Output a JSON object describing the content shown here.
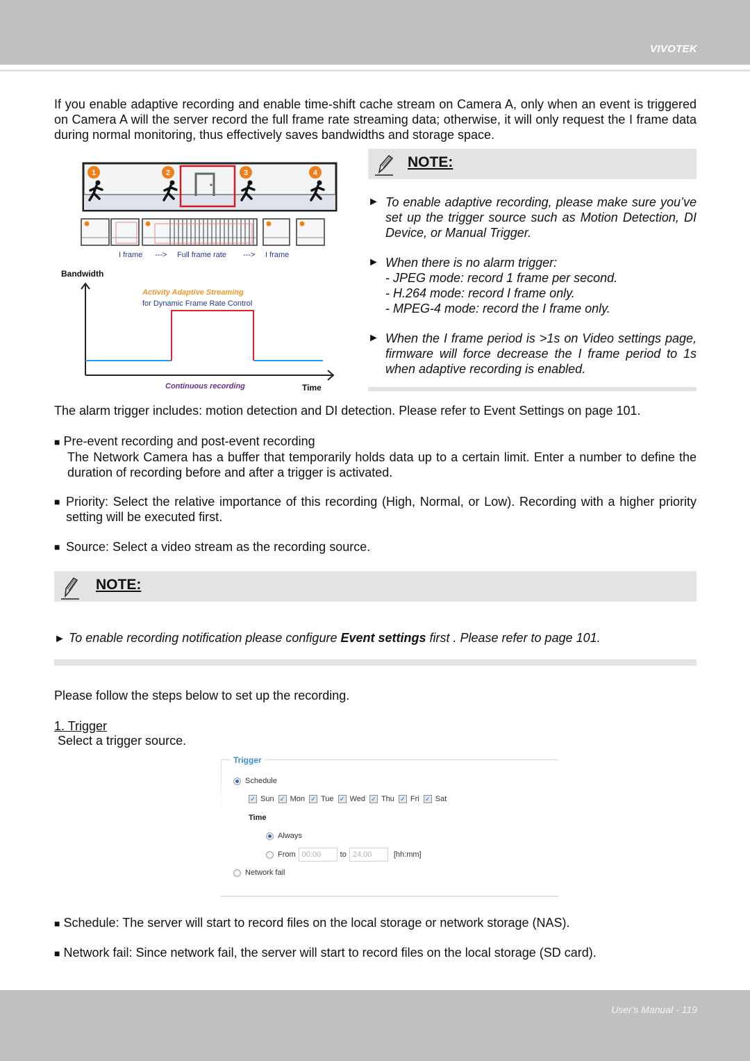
{
  "header": {
    "brand": "VIVOTEK"
  },
  "intro": "If you enable adaptive recording and enable time-shift cache stream on Camera A, only when an event is triggered on Camera A will the server record the full frame rate streaming data; otherwise, it will only request the I frame data during normal monitoring, thus effectively saves bandwidths and storage space.",
  "figure": {
    "steps": [
      "1",
      "2",
      "3",
      "4"
    ],
    "frame_labels": {
      "left": "I frame",
      "arrow1": "--->",
      "middle": "Full frame rate",
      "arrow2": "--->",
      "right": "I frame"
    },
    "ylabel": "Bandwidth",
    "xlabel": "Time",
    "title_orange": "Activity Adaptive Streaming",
    "title_blue": "for Dynamic Frame Rate Control",
    "baseline_label": "Continuous recording",
    "colors": {
      "baseline": "#1aa3e8",
      "event": "#e8202a",
      "orange": "#f0962c",
      "navy": "#2b3990",
      "purple": "#6a2c91",
      "badge": "#f07f1a"
    }
  },
  "note1": {
    "title": "NOTE:",
    "items": [
      "To enable adaptive recording, please make sure you’ve set up the trigger source such as Motion Detection, DI Device, or Manual Trigger.",
      "When there is no alarm trigger:",
      "When the I frame period is >1s on Video settings page, firmware will force decrease the I frame period to 1s when adaptive recording is enabled."
    ],
    "subitems": [
      "- JPEG mode: record 1 frame per second.",
      "- H.264 mode: record I frame only.",
      "- MPEG-4 mode: record the I frame only."
    ],
    "arrow": "►"
  },
  "alarm_text": "The alarm trigger includes: motion detection and DI detection. Please refer to Event Settings on page 101.",
  "bullets": {
    "marker": "■",
    "pre_event_title": "Pre-event recording and post-event recording",
    "pre_event_body": "The Network Camera has a buffer that temporarily holds data up to a certain limit. Enter a number to define the duration of recording before and after a trigger is activated.",
    "priority": "Priority: Select the relative importance of this recording (High, Normal, or Low). Recording with a higher priority setting will be executed first.",
    "source": "Source: Select a video stream as the recording source."
  },
  "note2": {
    "title": "NOTE:",
    "text_before": "To enable recording notification please configure ",
    "text_bold": "Event settings",
    "text_after": " first . Please refer to page 101."
  },
  "steps_intro": "Please follow the steps below to set up the recording.",
  "step1": {
    "title": "1. Trigger",
    "desc": "Select a trigger source."
  },
  "trigger_panel": {
    "legend": "Trigger",
    "schedule_label": "Schedule",
    "schedule_selected": true,
    "days": [
      {
        "label": "Sun",
        "checked": true
      },
      {
        "label": "Mon",
        "checked": true
      },
      {
        "label": "Tue",
        "checked": true
      },
      {
        "label": "Wed",
        "checked": true
      },
      {
        "label": "Thu",
        "checked": true
      },
      {
        "label": "Fri",
        "checked": true
      },
      {
        "label": "Sat",
        "checked": true
      }
    ],
    "time_label": "Time",
    "always_label": "Always",
    "always_selected": true,
    "from_label": "From",
    "from_value": "00:00",
    "to_label": "to",
    "to_value": "24:00",
    "unit_label": "[hh:mm]",
    "network_fail_label": "Network fail",
    "network_fail_selected": false
  },
  "bottom_bullets": [
    "Schedule: The server will start to record files on the local storage or network storage (NAS).",
    "Network fail: Since network fail, the server will start to record files on the local storage (SD card)."
  ],
  "footer": {
    "page_label": "User's Manual - 119"
  }
}
